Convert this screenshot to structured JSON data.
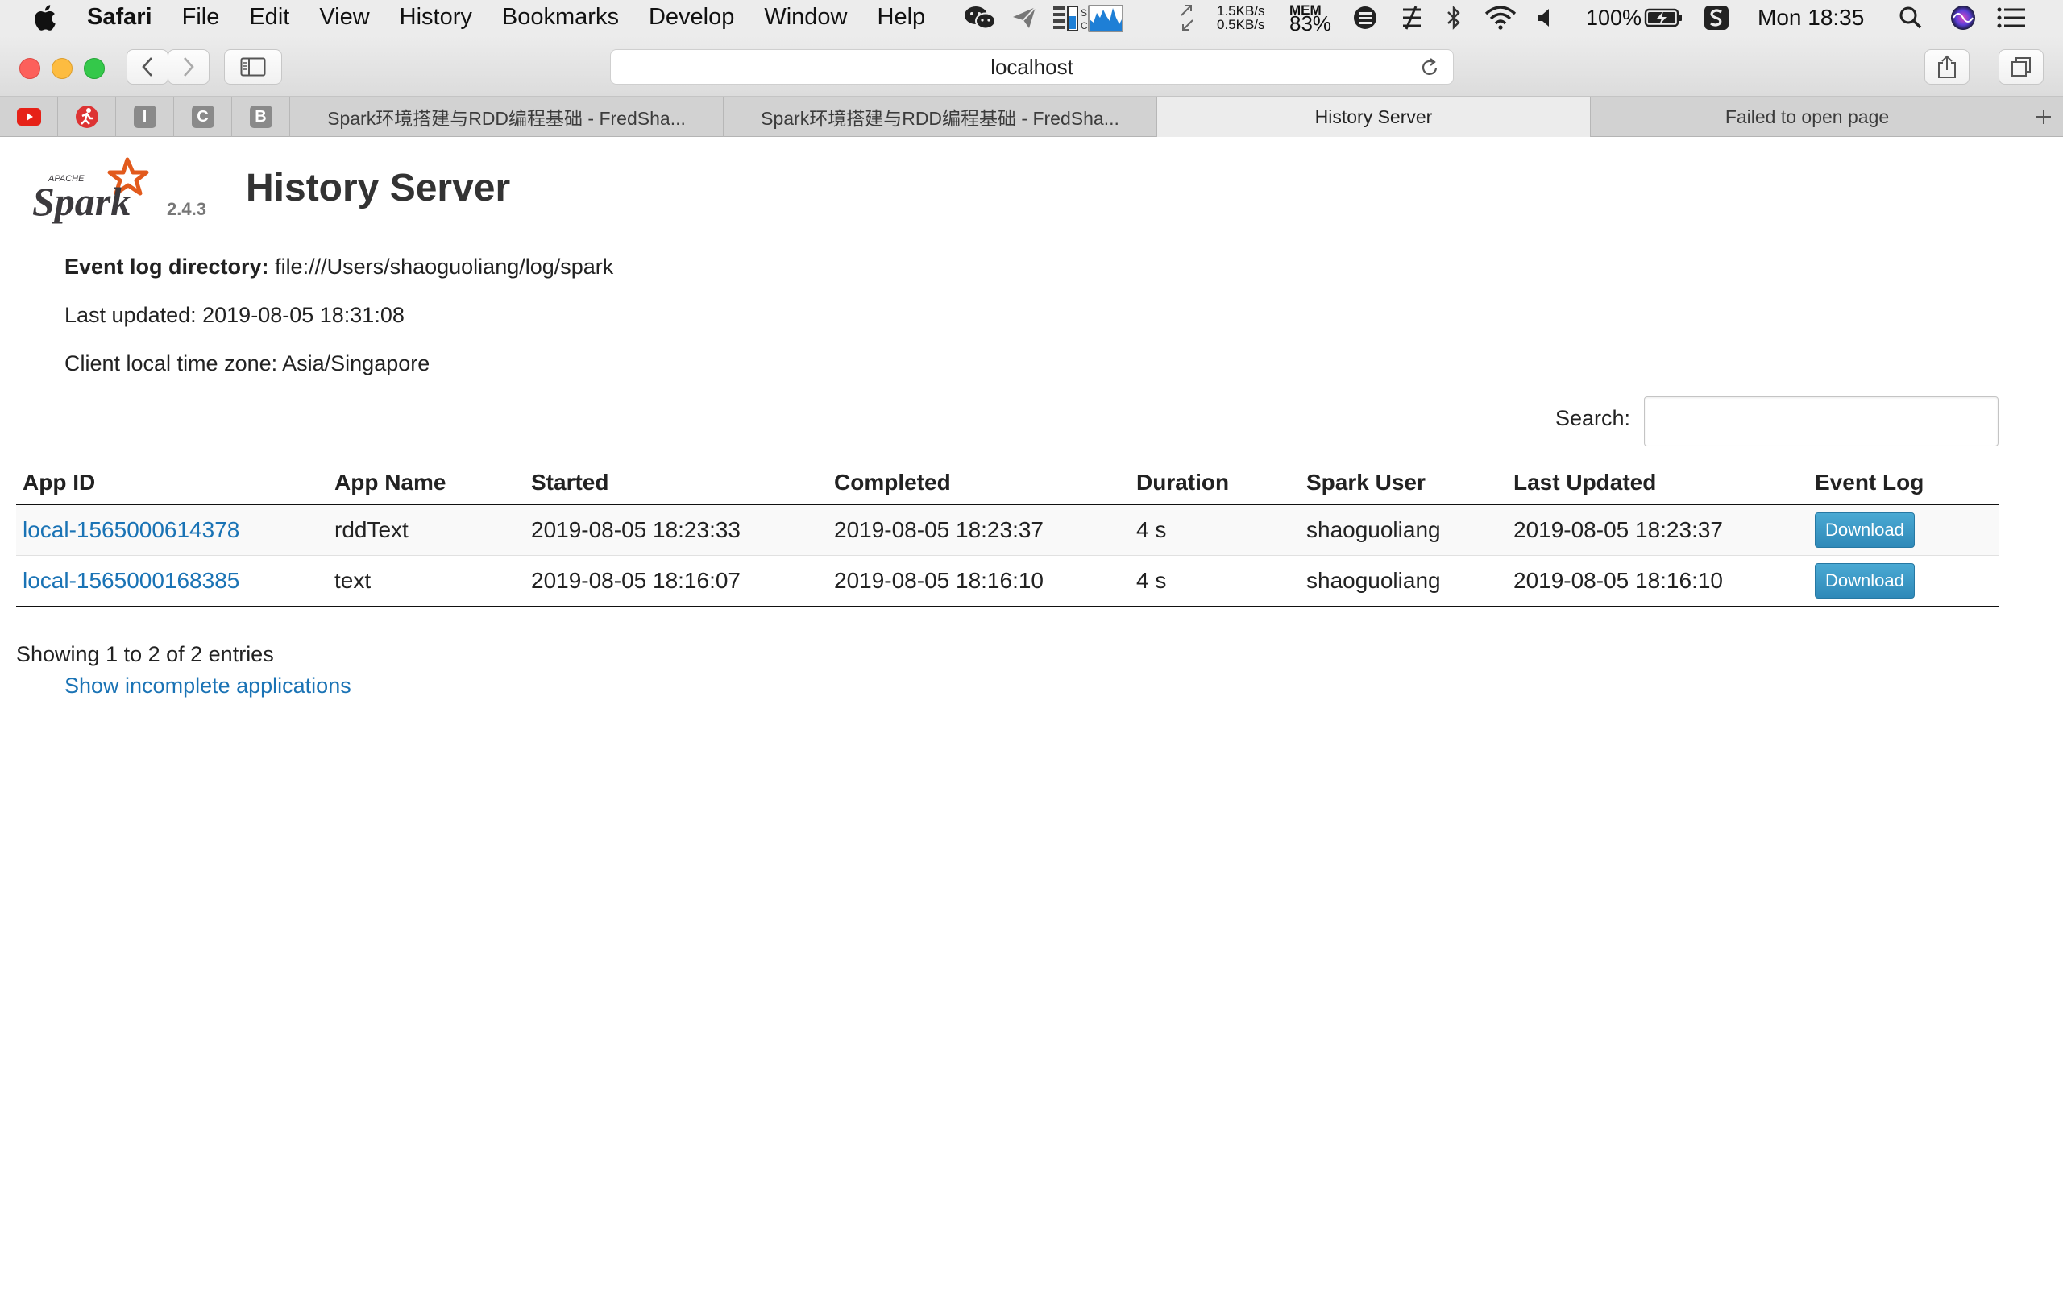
{
  "menubar": {
    "app_name": "Safari",
    "menus": [
      "File",
      "Edit",
      "View",
      "History",
      "Bookmarks",
      "Develop",
      "Window",
      "Help"
    ],
    "net_up": "1.5KB/s",
    "net_down": "0.5KB/s",
    "mem_label": "MEM",
    "mem_percent": "83%",
    "battery": "100%",
    "clock": "Mon 18:35"
  },
  "toolbar": {
    "url": "localhost"
  },
  "tabs": {
    "pinned": [
      "youtube",
      "runner",
      "I",
      "C",
      "B"
    ],
    "items": [
      {
        "label": "Spark环境搭建与RDD编程基础 - FredSha...",
        "active": false
      },
      {
        "label": "Spark环境搭建与RDD编程基础 - FredSha...",
        "active": false
      },
      {
        "label": "History Server",
        "active": true
      },
      {
        "label": "Failed to open page",
        "active": false
      }
    ]
  },
  "page": {
    "logo_text": "Spark",
    "logo_apache": "APACHE",
    "version": "2.4.3",
    "title": "History Server",
    "event_log_label": "Event log directory:",
    "event_log_value": "file:///Users/shaoguoliang/log/spark",
    "last_updated": "Last updated: 2019-08-05 18:31:08",
    "timezone": "Client local time zone: Asia/Singapore",
    "search_label": "Search:",
    "search_value": "",
    "columns": [
      "App ID",
      "App Name",
      "Started",
      "Completed",
      "Duration",
      "Spark User",
      "Last Updated",
      "Event Log"
    ],
    "rows": [
      {
        "app_id": "local-1565000614378",
        "app_name": "rddText",
        "started": "2019-08-05 18:23:33",
        "completed": "2019-08-05 18:23:37",
        "duration": "4 s",
        "user": "shaoguoliang",
        "last_updated": "2019-08-05 18:23:37",
        "event_log": "Download"
      },
      {
        "app_id": "local-1565000168385",
        "app_name": "text",
        "started": "2019-08-05 18:16:07",
        "completed": "2019-08-05 18:16:10",
        "duration": "4 s",
        "user": "shaoguoliang",
        "last_updated": "2019-08-05 18:16:10",
        "event_log": "Download"
      }
    ],
    "entries_info": "Showing 1 to 2 of 2 entries",
    "incomplete_link": "Show incomplete applications"
  },
  "colors": {
    "link": "#1a73b5",
    "spark_orange": "#e25a1c",
    "download_button": "#3a9ac7"
  }
}
